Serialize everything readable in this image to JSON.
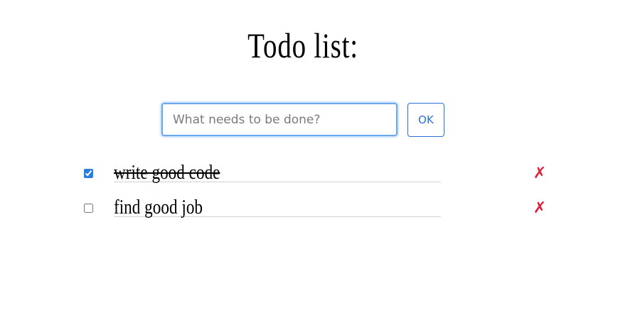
{
  "page": {
    "title": "Todo list:"
  },
  "new_todo": {
    "placeholder": "What needs to be done?",
    "value": "",
    "ok_label": "OK"
  },
  "todos": [
    {
      "text": "write good code",
      "done": true,
      "delete_icon": "✗"
    },
    {
      "text": "find good job",
      "done": false,
      "delete_icon": "✗"
    }
  ],
  "colors": {
    "accent": "#2a6fdb",
    "input_focus": "#6aa8f2",
    "delete": "#e0203a",
    "divider": "#cfcfcf"
  }
}
